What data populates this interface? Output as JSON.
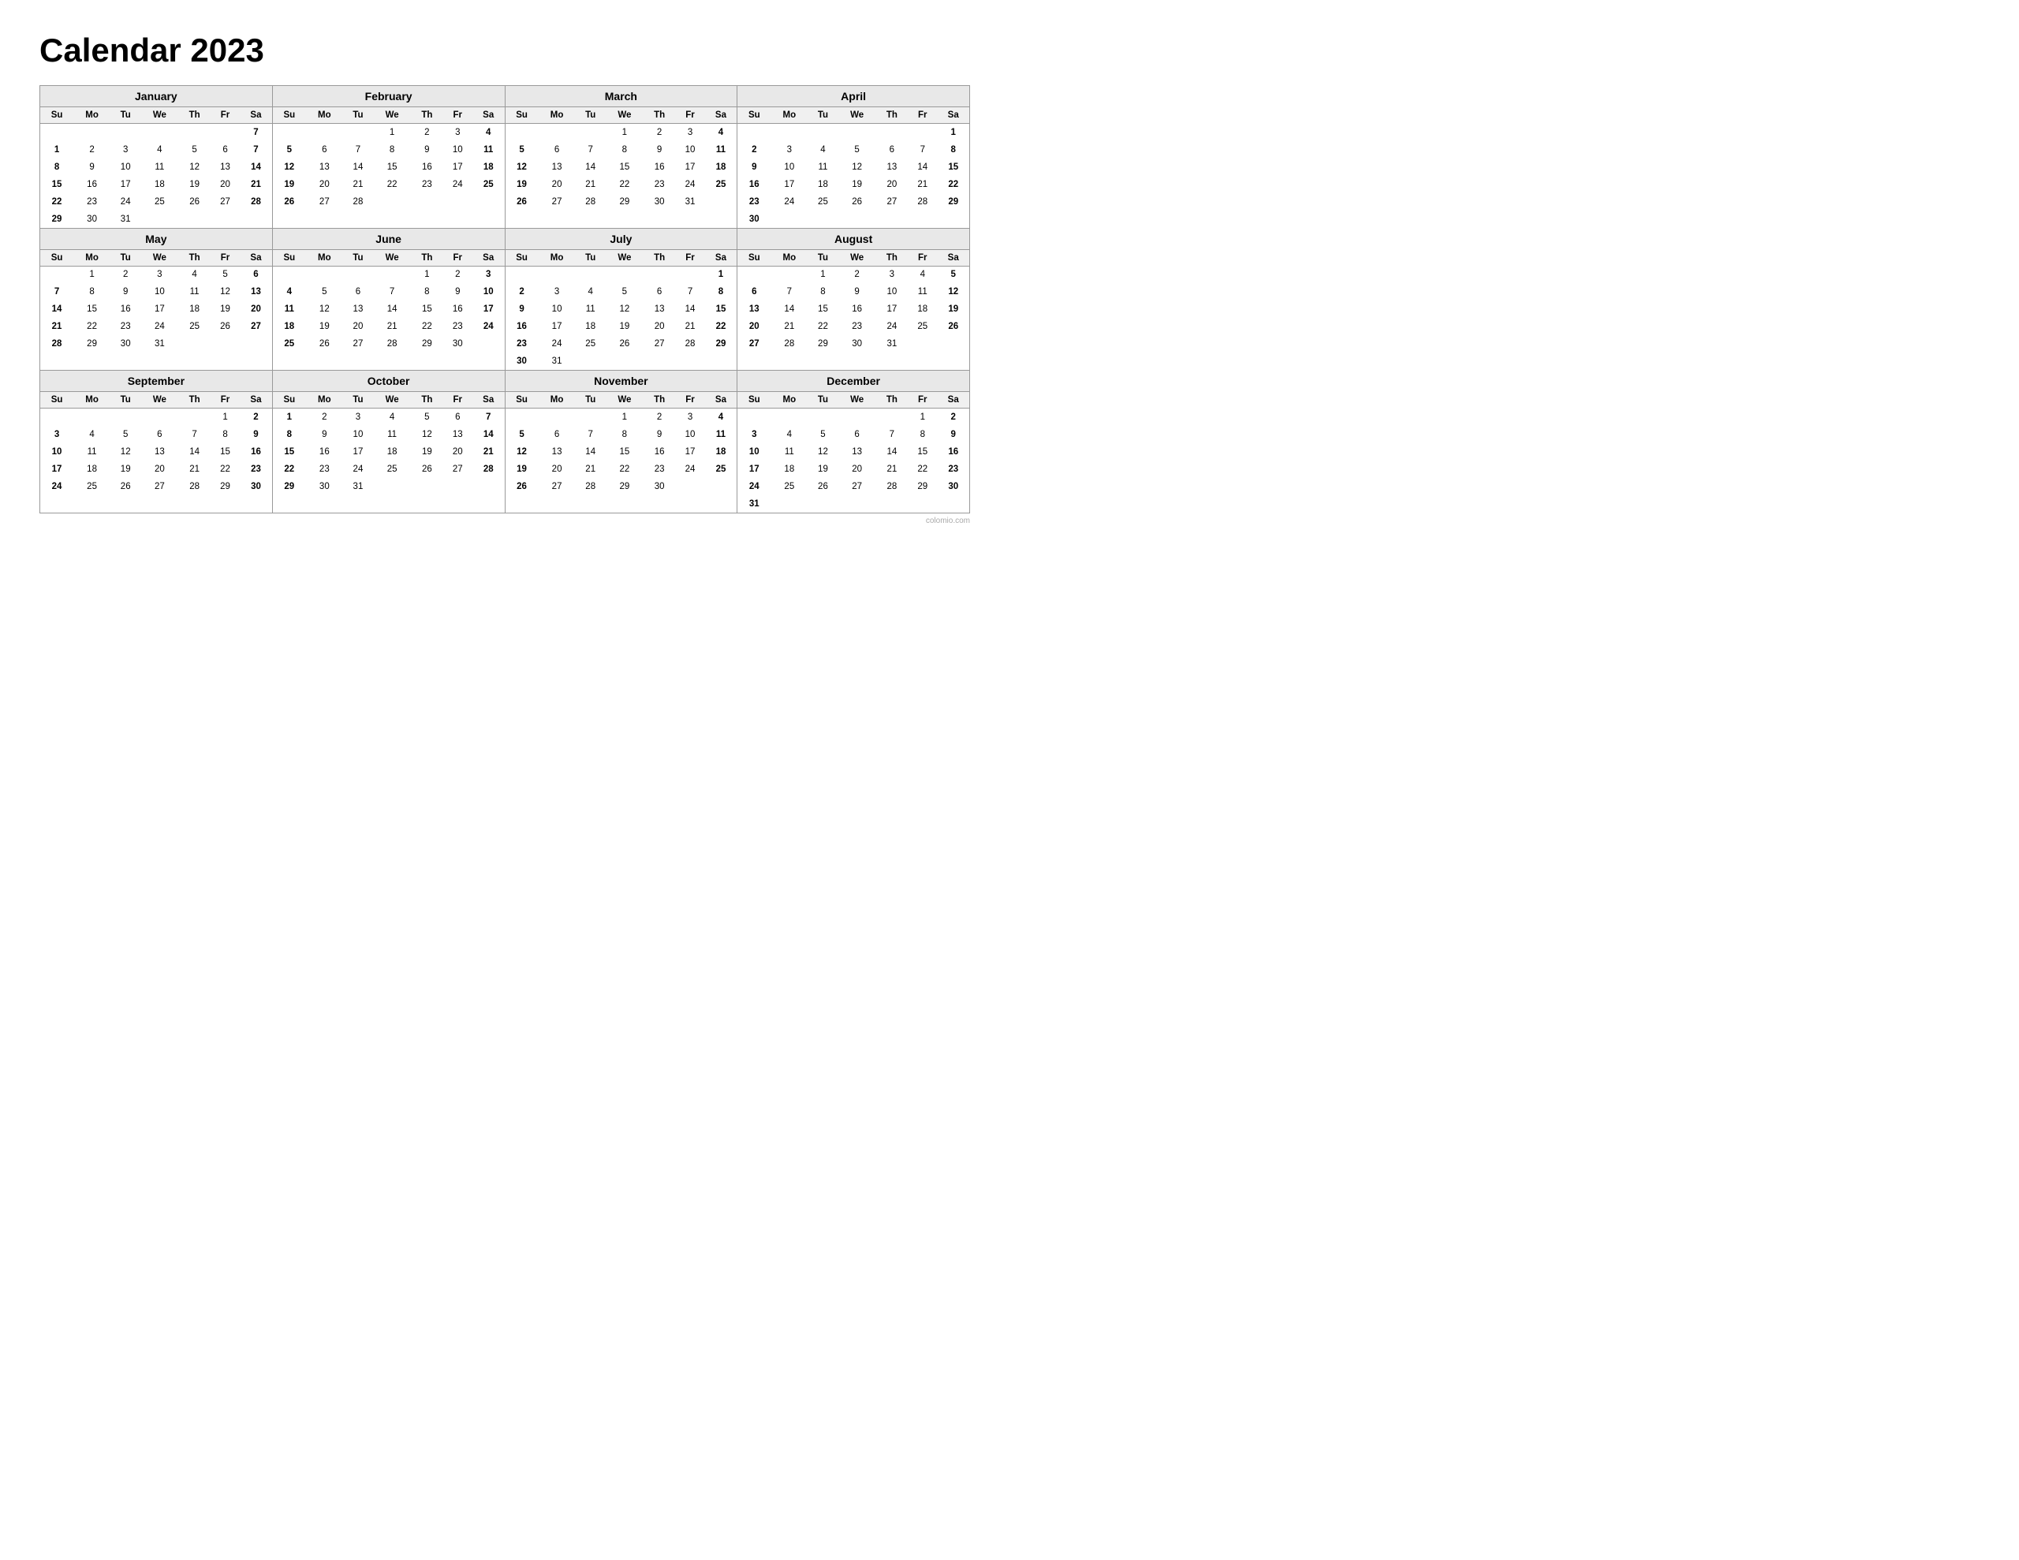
{
  "title": "Calendar 2023",
  "months": [
    {
      "name": "January",
      "days": [
        [
          "",
          "",
          "",
          "",
          "",
          "",
          "7"
        ],
        [
          "1",
          "2",
          "3",
          "4",
          "5",
          "6",
          "7"
        ],
        [
          "8",
          "9",
          "10",
          "11",
          "12",
          "13",
          "14"
        ],
        [
          "15",
          "16",
          "17",
          "18",
          "19",
          "20",
          "21"
        ],
        [
          "22",
          "23",
          "24",
          "25",
          "26",
          "27",
          "28"
        ],
        [
          "29",
          "30",
          "31",
          "",
          "",
          "",
          ""
        ]
      ]
    },
    {
      "name": "February",
      "days": [
        [
          "",
          "",
          "",
          "1",
          "2",
          "3",
          "4"
        ],
        [
          "5",
          "6",
          "7",
          "8",
          "9",
          "10",
          "11"
        ],
        [
          "12",
          "13",
          "14",
          "15",
          "16",
          "17",
          "18"
        ],
        [
          "19",
          "20",
          "21",
          "22",
          "23",
          "24",
          "25"
        ],
        [
          "26",
          "27",
          "28",
          "",
          "",
          "",
          ""
        ],
        [
          "",
          "",
          "",
          "",
          "",
          "",
          ""
        ]
      ]
    },
    {
      "name": "March",
      "days": [
        [
          "",
          "",
          "",
          "1",
          "2",
          "3",
          "4"
        ],
        [
          "5",
          "6",
          "7",
          "8",
          "9",
          "10",
          "11"
        ],
        [
          "12",
          "13",
          "14",
          "15",
          "16",
          "17",
          "18"
        ],
        [
          "19",
          "20",
          "21",
          "22",
          "23",
          "24",
          "25"
        ],
        [
          "26",
          "27",
          "28",
          "29",
          "30",
          "31",
          ""
        ],
        [
          "",
          "",
          "",
          "",
          "",
          "",
          ""
        ]
      ]
    },
    {
      "name": "April",
      "days": [
        [
          "",
          "",
          "",
          "",
          "",
          "",
          "1"
        ],
        [
          "2",
          "3",
          "4",
          "5",
          "6",
          "7",
          "8"
        ],
        [
          "9",
          "10",
          "11",
          "12",
          "13",
          "14",
          "15"
        ],
        [
          "16",
          "17",
          "18",
          "19",
          "20",
          "21",
          "22"
        ],
        [
          "23",
          "24",
          "25",
          "26",
          "27",
          "28",
          "29"
        ],
        [
          "30",
          "",
          "",
          "",
          "",
          "",
          ""
        ]
      ]
    },
    {
      "name": "May",
      "days": [
        [
          "",
          "1",
          "2",
          "3",
          "4",
          "5",
          "6"
        ],
        [
          "7",
          "8",
          "9",
          "10",
          "11",
          "12",
          "13"
        ],
        [
          "14",
          "15",
          "16",
          "17",
          "18",
          "19",
          "20"
        ],
        [
          "21",
          "22",
          "23",
          "24",
          "25",
          "26",
          "27"
        ],
        [
          "28",
          "29",
          "30",
          "31",
          "",
          "",
          ""
        ],
        [
          "",
          "",
          "",
          "",
          "",
          "",
          ""
        ]
      ]
    },
    {
      "name": "June",
      "days": [
        [
          "",
          "",
          "",
          "",
          "1",
          "2",
          "3"
        ],
        [
          "4",
          "5",
          "6",
          "7",
          "8",
          "9",
          "10"
        ],
        [
          "11",
          "12",
          "13",
          "14",
          "15",
          "16",
          "17"
        ],
        [
          "18",
          "19",
          "20",
          "21",
          "22",
          "23",
          "24"
        ],
        [
          "25",
          "26",
          "27",
          "28",
          "29",
          "30",
          ""
        ],
        [
          "",
          "",
          "",
          "",
          "",
          "",
          ""
        ]
      ]
    },
    {
      "name": "July",
      "days": [
        [
          "",
          "",
          "",
          "",
          "",
          "",
          "1"
        ],
        [
          "2",
          "3",
          "4",
          "5",
          "6",
          "7",
          "8"
        ],
        [
          "9",
          "10",
          "11",
          "12",
          "13",
          "14",
          "15"
        ],
        [
          "16",
          "17",
          "18",
          "19",
          "20",
          "21",
          "22"
        ],
        [
          "23",
          "24",
          "25",
          "26",
          "27",
          "28",
          "29"
        ],
        [
          "30",
          "31",
          "",
          "",
          "",
          "",
          ""
        ]
      ]
    },
    {
      "name": "August",
      "days": [
        [
          "",
          "",
          "1",
          "2",
          "3",
          "4",
          "5"
        ],
        [
          "6",
          "7",
          "8",
          "9",
          "10",
          "11",
          "12"
        ],
        [
          "13",
          "14",
          "15",
          "16",
          "17",
          "18",
          "19"
        ],
        [
          "20",
          "21",
          "22",
          "23",
          "24",
          "25",
          "26"
        ],
        [
          "27",
          "28",
          "29",
          "30",
          "31",
          "",
          ""
        ],
        [
          "",
          "",
          "",
          "",
          "",
          "",
          ""
        ]
      ]
    },
    {
      "name": "September",
      "days": [
        [
          "",
          "",
          "",
          "",
          "",
          "1",
          "2"
        ],
        [
          "3",
          "4",
          "5",
          "6",
          "7",
          "8",
          "9"
        ],
        [
          "10",
          "11",
          "12",
          "13",
          "14",
          "15",
          "16"
        ],
        [
          "17",
          "18",
          "19",
          "20",
          "21",
          "22",
          "23"
        ],
        [
          "24",
          "25",
          "26",
          "27",
          "28",
          "29",
          "30"
        ],
        [
          "",
          "",
          "",
          "",
          "",
          "",
          ""
        ]
      ]
    },
    {
      "name": "October",
      "days": [
        [
          "1",
          "2",
          "3",
          "4",
          "5",
          "6",
          "7"
        ],
        [
          "8",
          "9",
          "10",
          "11",
          "12",
          "13",
          "14"
        ],
        [
          "15",
          "16",
          "17",
          "18",
          "19",
          "20",
          "21"
        ],
        [
          "22",
          "23",
          "24",
          "25",
          "26",
          "27",
          "28"
        ],
        [
          "29",
          "30",
          "31",
          "",
          "",
          "",
          ""
        ],
        [
          "",
          "",
          "",
          "",
          "",
          "",
          ""
        ]
      ]
    },
    {
      "name": "November",
      "days": [
        [
          "",
          "",
          "",
          "1",
          "2",
          "3",
          "4"
        ],
        [
          "5",
          "6",
          "7",
          "8",
          "9",
          "10",
          "11"
        ],
        [
          "12",
          "13",
          "14",
          "15",
          "16",
          "17",
          "18"
        ],
        [
          "19",
          "20",
          "21",
          "22",
          "23",
          "24",
          "25"
        ],
        [
          "26",
          "27",
          "28",
          "29",
          "30",
          "",
          ""
        ],
        [
          "",
          "",
          "",
          "",
          "",
          "",
          ""
        ]
      ]
    },
    {
      "name": "December",
      "days": [
        [
          "",
          "",
          "",
          "",
          "",
          "1",
          "2"
        ],
        [
          "3",
          "4",
          "5",
          "6",
          "7",
          "8",
          "9"
        ],
        [
          "10",
          "11",
          "12",
          "13",
          "14",
          "15",
          "16"
        ],
        [
          "17",
          "18",
          "19",
          "20",
          "21",
          "22",
          "23"
        ],
        [
          "24",
          "25",
          "26",
          "27",
          "28",
          "29",
          "30"
        ],
        [
          "31",
          "",
          "",
          "",
          "",
          "",
          ""
        ]
      ]
    }
  ],
  "weekdays": [
    "Su",
    "Mo",
    "Tu",
    "We",
    "Th",
    "Fr",
    "Sa"
  ],
  "watermark": "colomio.com"
}
